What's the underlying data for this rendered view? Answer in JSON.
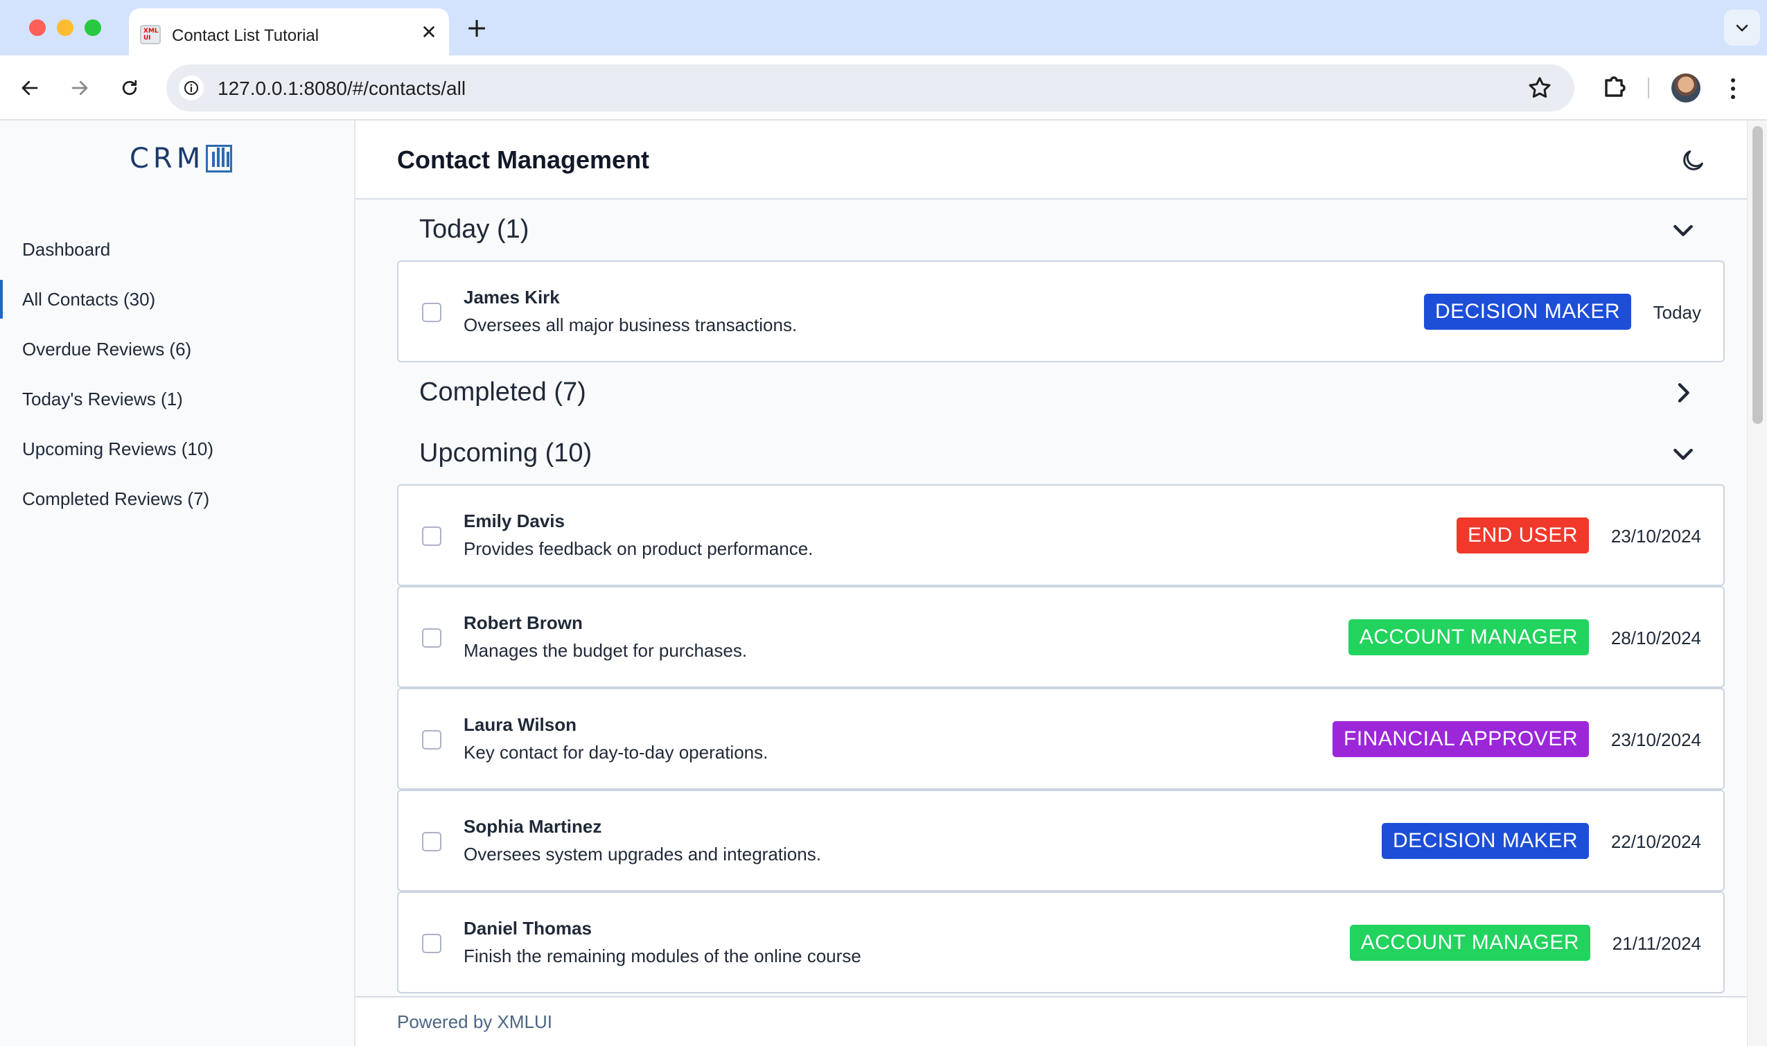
{
  "browser": {
    "tab_title": "Contact List Tutorial",
    "favicon_text": "XML UI",
    "url": "127.0.0.1:8080/#/contacts/all"
  },
  "sidebar": {
    "logo_text": "CRM",
    "items": [
      {
        "label": "Dashboard",
        "active": false
      },
      {
        "label": "All Contacts (30)",
        "active": true
      },
      {
        "label": "Overdue Reviews (6)",
        "active": false
      },
      {
        "label": "Today's Reviews (1)",
        "active": false
      },
      {
        "label": "Upcoming Reviews (10)",
        "active": false
      },
      {
        "label": "Completed Reviews (7)",
        "active": false
      }
    ]
  },
  "header": {
    "title": "Contact Management"
  },
  "sections": [
    {
      "title": "Today (1)",
      "expanded": true,
      "contacts": [
        {
          "name": "James Kirk",
          "description": "Oversees all major business transactions.",
          "badge": "DECISION MAKER",
          "badge_color": "#1d4ed8",
          "date": "Today"
        }
      ]
    },
    {
      "title": "Completed (7)",
      "expanded": false,
      "contacts": []
    },
    {
      "title": "Upcoming (10)",
      "expanded": true,
      "contacts": [
        {
          "name": "Emily Davis",
          "description": "Provides feedback on product performance.",
          "badge": "END USER",
          "badge_color": "#f0392b",
          "date": "23/10/2024"
        },
        {
          "name": "Robert Brown",
          "description": "Manages the budget for purchases.",
          "badge": "ACCOUNT MANAGER",
          "badge_color": "#22d35e",
          "date": "28/10/2024"
        },
        {
          "name": "Laura Wilson",
          "description": "Key contact for day-to-day operations.",
          "badge": "FINANCIAL APPROVER",
          "badge_color": "#9b27d9",
          "date": "23/10/2024"
        },
        {
          "name": "Sophia Martinez",
          "description": "Oversees system upgrades and integrations.",
          "badge": "DECISION MAKER",
          "badge_color": "#1d4ed8",
          "date": "22/10/2024"
        },
        {
          "name": "Daniel Thomas",
          "description": "Finish the remaining modules of the online course",
          "badge": "ACCOUNT MANAGER",
          "badge_color": "#22d35e",
          "date": "21/11/2024"
        }
      ]
    }
  ],
  "footer": {
    "text": "Powered by XMLUI"
  },
  "icons": {
    "back": "arrow-left-icon",
    "forward": "arrow-right-icon",
    "reload": "reload-icon",
    "site_info": "info-icon",
    "bookmark": "star-icon",
    "extensions": "puzzle-icon",
    "menu": "kebab-icon",
    "theme": "moon-icon",
    "expanded": "chevron-down-icon",
    "collapsed": "chevron-right-icon"
  }
}
